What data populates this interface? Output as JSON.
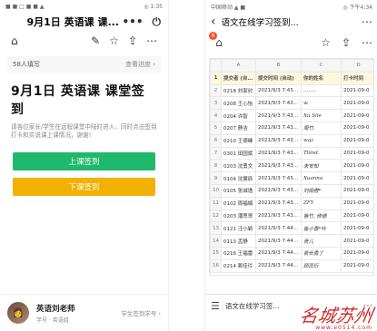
{
  "left": {
    "status": {
      "left": "■ ■ □ ■ ■ ▲",
      "right": "◎ 1:35"
    },
    "title": "9月1日 英语课 课...",
    "menu_icon": "more-dots-icon",
    "power_icon": "power-icon",
    "count_label": "58人填写",
    "progress_label": "查看进度",
    "form_title": "9月1日 英语课 课堂签到",
    "form_desc": "请各位家长/学生在远程课堂中陆时进入，同时点击签到打卡和实说课上课情况，谢谢!",
    "btn_checkin": "上课签到",
    "btn_checkout": "下课签到",
    "teacher_name": "英语刘老师",
    "teacher_sub": "学号 · 英语组",
    "teacher_link": "学生签到学号 ›"
  },
  "right": {
    "status": {
      "left": "中国移动 ▲ ■",
      "right": "◎ 下午4:34"
    },
    "title": "语文在线学习签到...",
    "badge": "6",
    "columns": [
      "A",
      "B",
      "C",
      "D"
    ],
    "header": [
      "提交者 (自动)",
      "提交时间 (自动)",
      "你的姓名",
      "打卡时间"
    ],
    "rows": [
      [
        "0218 刘家欣",
        "2021/9/3 7:43:28",
        "........",
        "2021-09-0"
      ],
      [
        "0208 王心怡",
        "2021/9/3 7:43:29",
        "w.",
        "2021-09-0"
      ],
      [
        "0204 许智",
        "2021/9/3 7:43:34",
        "Xu Sile",
        "2021-09-0"
      ],
      [
        "0207 静洁",
        "2021/9/3 7:43:35",
        "周竹.",
        "2021-09-0"
      ],
      [
        "0210 王德峰",
        "2021/9/3 7:43:44",
        "wqz",
        "2021-09-0"
      ],
      [
        "0301 田园斌",
        "2021/9/3 7:43:44",
        "Tliiiet.",
        "2021-09-0"
      ],
      [
        "0203 沈勇文",
        "2021/9/3 7:43:48",
        "未安知",
        "2021-09-0"
      ],
      [
        "0104 沈翼辰",
        "2021/9/3 7:43:54",
        "Xuannu",
        "2021-09-0"
      ],
      [
        "0105 张诚逸",
        "2021/9/3 7:43:56",
        "刘雨橙*",
        "2021-09-0"
      ],
      [
        "0102 周福娟",
        "2021/9/3 7:43:57",
        "ZFY",
        "2021-09-0"
      ],
      [
        "0203 潘思贤",
        "2021/9/3 7:43:59",
        "鲁竹, 修德",
        "2021-09-0"
      ],
      [
        "0121 汪小颖",
        "2021/9/3 7:44:09",
        "鱼小香*吟",
        "2021-09-0"
      ],
      [
        "0113 孟静",
        "2021/9/3 7:44:12",
        "贵儿",
        "2021-09-0"
      ],
      [
        "0216 王福雷",
        "2021/9/3 7:44:12",
        "若长勇了",
        "2021-09-0"
      ],
      [
        "0214 赖佳玲",
        "2021/9/3 7:44:14",
        "顾蕊衍",
        "2021-09-0"
      ]
    ],
    "sheet_name": "语文在线学习签...",
    "watermark_big": "名城苏州",
    "watermark_small": "www.e0514.com"
  }
}
